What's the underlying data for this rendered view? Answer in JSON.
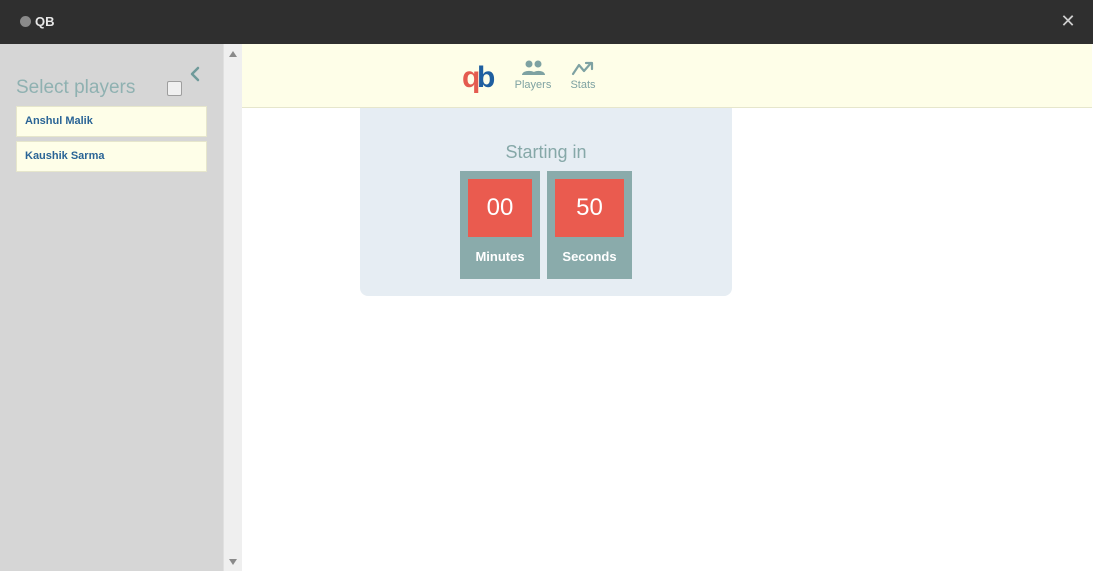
{
  "window": {
    "title": "QB",
    "close_symbol": "✕",
    "app_icon": "app-icon"
  },
  "sidebar": {
    "title": "Select players",
    "select_all_checked": false,
    "collapse_icon": "chevron-left-icon",
    "players": [
      {
        "name": "Anshul Malik"
      },
      {
        "name": "Kaushik Sarma"
      }
    ]
  },
  "navbar": {
    "logo": {
      "q": "q",
      "b": "b",
      "colors": {
        "q": "#e45b4f",
        "b": "#1f5fa0"
      }
    },
    "items": [
      {
        "label": "Players",
        "icon": "users-icon"
      },
      {
        "label": "Stats",
        "icon": "trending-chart-icon"
      }
    ]
  },
  "countdown": {
    "label": "Starting in",
    "minutes": {
      "value": "00",
      "unit": "Minutes"
    },
    "seconds": {
      "value": "50",
      "unit": "Seconds"
    }
  },
  "colors": {
    "accent_red": "#ea5b4f",
    "teal": "#8aabab",
    "nav_bg": "#fefee8",
    "sidebar_bg": "#d6d6d6",
    "panel_bg": "#e6edf3"
  }
}
